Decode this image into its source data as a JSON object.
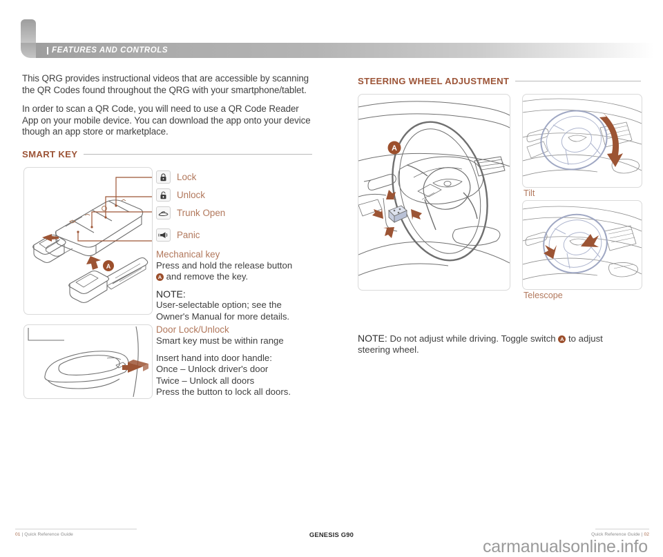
{
  "header": {
    "section_title": "FEATURES AND CONTROLS"
  },
  "left_column": {
    "intro_paragraph_1": "This QRG provides instructional videos that are accessible by scanning the QR Codes found throughout the QRG with your smartphone/tablet.",
    "intro_paragraph_2": "In order to scan a QR Code, you will need to use a QR Code Reader App on your mobile device.  You can download the app onto your device though an app store or marketplace.",
    "smart_key": {
      "heading": "SMART KEY",
      "legend": [
        {
          "icon": "lock-closed-icon",
          "label": "Lock"
        },
        {
          "icon": "lock-open-icon",
          "label": "Unlock"
        },
        {
          "icon": "trunk-open-icon",
          "label": "Trunk Open"
        },
        {
          "icon": "panic-horn-icon",
          "label": "Panic"
        }
      ],
      "mechanical_key_heading": "Mechanical key",
      "mechanical_key_text_before": "Press and hold the release button",
      "mechanical_key_badge": "A",
      "mechanical_key_text_after": "and remove the key.",
      "note_label": "NOTE:",
      "note_text": "User-selectable option; see the Owner's Manual for more details."
    },
    "door_lock": {
      "heading": "Door Lock/Unlock",
      "subtext": "Smart key must be within range",
      "lines": [
        "Insert hand into door handle:",
        "Once – Unlock driver's door",
        "Twice – Unlock all doors",
        "Press the button to lock all doors."
      ]
    }
  },
  "right_column": {
    "heading": "STEERING WHEEL  ADJUSTMENT",
    "tilt_caption": "Tilt",
    "telescope_caption": "Telescope",
    "note_label": "NOTE:",
    "note_text_before": "Do not adjust while driving. Toggle switch",
    "note_badge": "A",
    "note_text_after": "to adjust steering wheel."
  },
  "footer": {
    "left_page": "01",
    "left_text": "Quick Reference Guide",
    "center": "GENESIS G90",
    "right_text": "Quick Reference Guide",
    "right_page": "02",
    "watermark": "carmanualsonline.info"
  },
  "colors": {
    "accent_heading": "#9c5437",
    "accent_label": "#b1775b",
    "badge": "#9c4f2c",
    "illustration_line": "#6b6b6b",
    "illustration_arrow": "#9c5434"
  }
}
